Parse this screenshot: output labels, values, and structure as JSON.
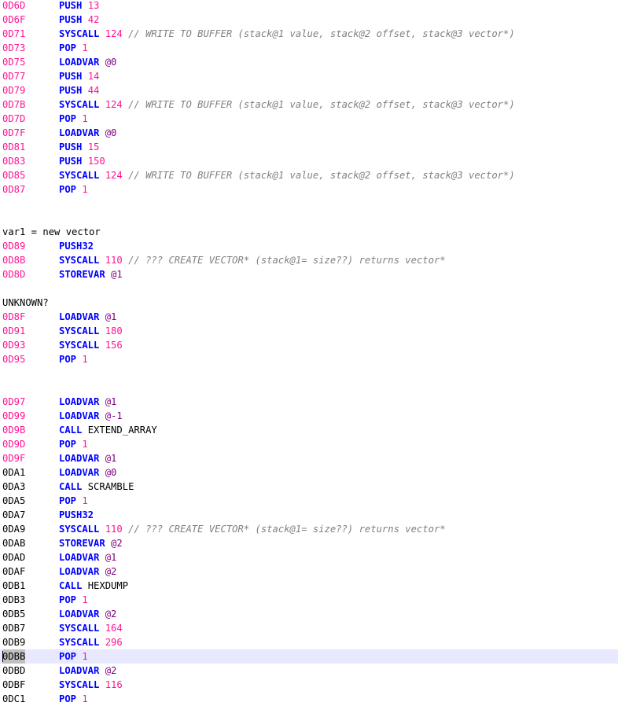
{
  "comment_write": "// WRITE TO BUFFER (stack@1 value, stack@2 offset, stack@3 vector*)",
  "comment_create": "// ??? CREATE VECTOR* (stack@1= size??) returns vector*",
  "lines": [
    {
      "addr": "0D6D",
      "ac": "pink",
      "op": "PUSH",
      "args": [
        {
          "t": "num",
          "v": "13"
        }
      ]
    },
    {
      "addr": "0D6F",
      "ac": "pink",
      "op": "PUSH",
      "args": [
        {
          "t": "num",
          "v": "42"
        }
      ]
    },
    {
      "addr": "0D71",
      "ac": "pink",
      "op": "SYSCALL",
      "args": [
        {
          "t": "num",
          "v": "124"
        }
      ],
      "comment": "// WRITE TO BUFFER (stack@1 value, stack@2 offset, stack@3 vector*)"
    },
    {
      "addr": "0D73",
      "ac": "pink",
      "op": "POP",
      "args": [
        {
          "t": "num",
          "v": "1"
        }
      ]
    },
    {
      "addr": "0D75",
      "ac": "pink",
      "op": "LOADVAR",
      "args": [
        {
          "t": "var",
          "v": "@0"
        }
      ]
    },
    {
      "addr": "0D77",
      "ac": "pink",
      "op": "PUSH",
      "args": [
        {
          "t": "num",
          "v": "14"
        }
      ]
    },
    {
      "addr": "0D79",
      "ac": "pink",
      "op": "PUSH",
      "args": [
        {
          "t": "num",
          "v": "44"
        }
      ]
    },
    {
      "addr": "0D7B",
      "ac": "pink",
      "op": "SYSCALL",
      "args": [
        {
          "t": "num",
          "v": "124"
        }
      ],
      "comment": "// WRITE TO BUFFER (stack@1 value, stack@2 offset, stack@3 vector*)"
    },
    {
      "addr": "0D7D",
      "ac": "pink",
      "op": "POP",
      "args": [
        {
          "t": "num",
          "v": "1"
        }
      ]
    },
    {
      "addr": "0D7F",
      "ac": "pink",
      "op": "LOADVAR",
      "args": [
        {
          "t": "var",
          "v": "@0"
        }
      ]
    },
    {
      "addr": "0D81",
      "ac": "pink",
      "op": "PUSH",
      "args": [
        {
          "t": "num",
          "v": "15"
        }
      ]
    },
    {
      "addr": "0D83",
      "ac": "pink",
      "op": "PUSH",
      "args": [
        {
          "t": "num",
          "v": "150"
        }
      ]
    },
    {
      "addr": "0D85",
      "ac": "pink",
      "op": "SYSCALL",
      "args": [
        {
          "t": "num",
          "v": "124"
        }
      ],
      "comment": "// WRITE TO BUFFER (stack@1 value, stack@2 offset, stack@3 vector*)"
    },
    {
      "addr": "0D87",
      "ac": "pink",
      "op": "POP",
      "args": [
        {
          "t": "num",
          "v": "1"
        }
      ]
    },
    {
      "blank": true
    },
    {
      "blank": true
    },
    {
      "text": "var1 = new vector"
    },
    {
      "addr": "0D89",
      "ac": "pink",
      "op": "PUSH32",
      "args": []
    },
    {
      "addr": "0D8B",
      "ac": "pink",
      "op": "SYSCALL",
      "args": [
        {
          "t": "num",
          "v": "110"
        }
      ],
      "comment": "// ??? CREATE VECTOR* (stack@1= size??) returns vector*"
    },
    {
      "addr": "0D8D",
      "ac": "pink",
      "op": "STOREVAR",
      "args": [
        {
          "t": "var",
          "v": "@1"
        }
      ]
    },
    {
      "blank": true
    },
    {
      "text": "UNKNOWN?"
    },
    {
      "addr": "0D8F",
      "ac": "pink",
      "op": "LOADVAR",
      "args": [
        {
          "t": "var",
          "v": "@1"
        }
      ]
    },
    {
      "addr": "0D91",
      "ac": "pink",
      "op": "SYSCALL",
      "args": [
        {
          "t": "num",
          "v": "180"
        }
      ]
    },
    {
      "addr": "0D93",
      "ac": "pink",
      "op": "SYSCALL",
      "args": [
        {
          "t": "num",
          "v": "156"
        }
      ]
    },
    {
      "addr": "0D95",
      "ac": "pink",
      "op": "POP",
      "args": [
        {
          "t": "num",
          "v": "1"
        }
      ]
    },
    {
      "blank": true
    },
    {
      "blank": true
    },
    {
      "addr": "0D97",
      "ac": "pink",
      "op": "LOADVAR",
      "args": [
        {
          "t": "var",
          "v": "@1"
        }
      ]
    },
    {
      "addr": "0D99",
      "ac": "pink",
      "op": "LOADVAR",
      "args": [
        {
          "t": "var",
          "v": "@-1"
        }
      ]
    },
    {
      "addr": "0D9B",
      "ac": "pink",
      "op": "CALL",
      "args": [
        {
          "t": "ident",
          "v": "EXTEND_ARRAY"
        }
      ]
    },
    {
      "addr": "0D9D",
      "ac": "pink",
      "op": "POP",
      "args": [
        {
          "t": "num",
          "v": "1"
        }
      ]
    },
    {
      "addr": "0D9F",
      "ac": "pink",
      "op": "LOADVAR",
      "args": [
        {
          "t": "var",
          "v": "@1"
        }
      ]
    },
    {
      "addr": "0DA1",
      "ac": "black",
      "op": "LOADVAR",
      "args": [
        {
          "t": "var",
          "v": "@0"
        }
      ]
    },
    {
      "addr": "0DA3",
      "ac": "black",
      "op": "CALL",
      "args": [
        {
          "t": "ident",
          "v": "SCRAMBLE"
        }
      ]
    },
    {
      "addr": "0DA5",
      "ac": "black",
      "op": "POP",
      "args": [
        {
          "t": "num",
          "v": "1"
        }
      ]
    },
    {
      "addr": "0DA7",
      "ac": "black",
      "op": "PUSH32",
      "args": []
    },
    {
      "addr": "0DA9",
      "ac": "black",
      "op": "SYSCALL",
      "args": [
        {
          "t": "num",
          "v": "110"
        }
      ],
      "comment": "// ??? CREATE VECTOR* (stack@1= size??) returns vector*"
    },
    {
      "addr": "0DAB",
      "ac": "black",
      "op": "STOREVAR",
      "args": [
        {
          "t": "var",
          "v": "@2"
        }
      ]
    },
    {
      "addr": "0DAD",
      "ac": "black",
      "op": "LOADVAR",
      "args": [
        {
          "t": "var",
          "v": "@1"
        }
      ]
    },
    {
      "addr": "0DAF",
      "ac": "black",
      "op": "LOADVAR",
      "args": [
        {
          "t": "var",
          "v": "@2"
        }
      ]
    },
    {
      "addr": "0DB1",
      "ac": "black",
      "op": "CALL",
      "args": [
        {
          "t": "ident",
          "v": "HEXDUMP"
        }
      ]
    },
    {
      "addr": "0DB3",
      "ac": "black",
      "op": "POP",
      "args": [
        {
          "t": "num",
          "v": "1"
        }
      ]
    },
    {
      "addr": "0DB5",
      "ac": "black",
      "op": "LOADVAR",
      "args": [
        {
          "t": "var",
          "v": "@2"
        }
      ]
    },
    {
      "addr": "0DB7",
      "ac": "black",
      "op": "SYSCALL",
      "args": [
        {
          "t": "num",
          "v": "164"
        }
      ]
    },
    {
      "addr": "0DB9",
      "ac": "black",
      "op": "SYSCALL",
      "args": [
        {
          "t": "num",
          "v": "296"
        }
      ]
    },
    {
      "addr": "0DBB",
      "ac": "black",
      "op": "POP",
      "args": [
        {
          "t": "num",
          "v": "1"
        }
      ],
      "highlight": true
    },
    {
      "addr": "0DBD",
      "ac": "black",
      "op": "LOADVAR",
      "args": [
        {
          "t": "var",
          "v": "@2"
        }
      ]
    },
    {
      "addr": "0DBF",
      "ac": "black",
      "op": "SYSCALL",
      "args": [
        {
          "t": "num",
          "v": "116"
        }
      ]
    },
    {
      "addr": "0DC1",
      "ac": "black",
      "op": "POP",
      "args": [
        {
          "t": "num",
          "v": "1"
        }
      ]
    }
  ]
}
